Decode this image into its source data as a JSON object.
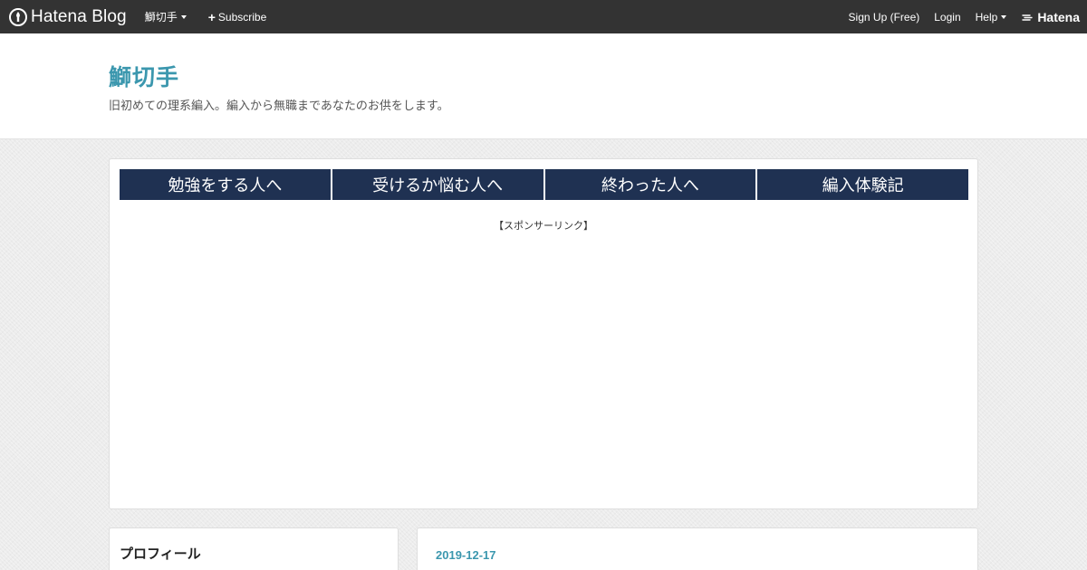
{
  "topbar": {
    "logo_text": "Hatena Blog",
    "blog_menu_label": "鰤切手",
    "subscribe_label": "Subscribe",
    "signup_label": "Sign Up (Free)",
    "login_label": "Login",
    "help_label": "Help",
    "brand_label": "Hatena"
  },
  "header": {
    "title": "鰤切手",
    "description": "旧初めての理系編入。編入から無職まであなたのお供をします。"
  },
  "menu": {
    "items": [
      {
        "label": "勉強をする人へ"
      },
      {
        "label": "受けるか悩む人へ"
      },
      {
        "label": "終わった人へ"
      },
      {
        "label": "編入体験記"
      }
    ]
  },
  "sponsor_label": "【スポンサーリンク】",
  "sidebar": {
    "profile_title": "プロフィール"
  },
  "entry": {
    "date": "2019-12-17"
  },
  "colors": {
    "topbar_bg": "#333333",
    "title_accent": "#3b97ae",
    "menu_bg": "#1f3152"
  },
  "icons": {
    "logo": "hatena-blog-logo-icon",
    "brand": "hatena-brand-icon",
    "subscribe": "plus-icon",
    "dropdown": "caret-down-icon"
  }
}
